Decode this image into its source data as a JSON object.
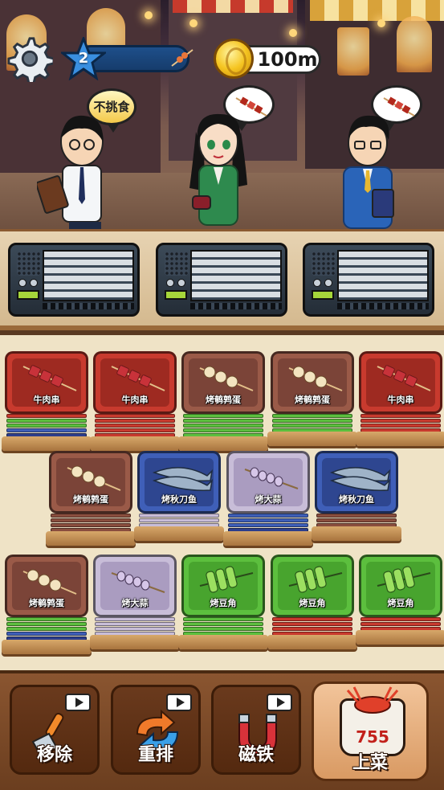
{
  "hud": {
    "level": "2",
    "coins": "100m"
  },
  "customers": [
    {
      "name": "customer-1",
      "bubble_text": "不挑食",
      "bubble_icon": "none"
    },
    {
      "name": "customer-2",
      "bubble_text": "",
      "bubble_icon": "beef-skewer-icon"
    },
    {
      "name": "customer-3",
      "bubble_text": "",
      "bubble_icon": "beef-skewer-icon"
    }
  ],
  "grid": {
    "rows": [
      [
        {
          "label": "牛肉串",
          "food": "beef-skewer-icon",
          "color": "red"
        },
        {
          "label": "牛肉串",
          "food": "beef-skewer-icon",
          "color": "red"
        },
        {
          "label": "烤鹌鹑蛋",
          "food": "quail-egg-skewer-icon",
          "color": "brown"
        },
        {
          "label": "烤鹌鹑蛋",
          "food": "quail-egg-skewer-icon",
          "color": "brown"
        },
        {
          "label": "牛肉串",
          "food": "beef-skewer-icon",
          "color": "red"
        }
      ],
      [
        {
          "label": "烤鹌鹑蛋",
          "food": "quail-egg-skewer-icon",
          "color": "brown"
        },
        {
          "label": "烤秋刀鱼",
          "food": "saury-fish-icon",
          "color": "blue"
        },
        {
          "label": "烤大蒜",
          "food": "garlic-skewer-icon",
          "color": "lilac"
        },
        {
          "label": "烤秋刀鱼",
          "food": "saury-fish-icon",
          "color": "blue"
        }
      ],
      [
        {
          "label": "烤鹌鹑蛋",
          "food": "quail-egg-skewer-icon",
          "color": "brown"
        },
        {
          "label": "烤大蒜",
          "food": "garlic-skewer-icon",
          "color": "lilac"
        },
        {
          "label": "烤豆角",
          "food": "green-bean-skewer-icon",
          "color": "green"
        },
        {
          "label": "烤豆角",
          "food": "green-bean-skewer-icon",
          "color": "green"
        },
        {
          "label": "烤豆角",
          "food": "green-bean-skewer-icon",
          "color": "green"
        }
      ]
    ]
  },
  "tools": {
    "remove": "移除",
    "shuffle": "重排",
    "magnet": "磁铁",
    "serve": "上菜",
    "serve_count": "755"
  }
}
